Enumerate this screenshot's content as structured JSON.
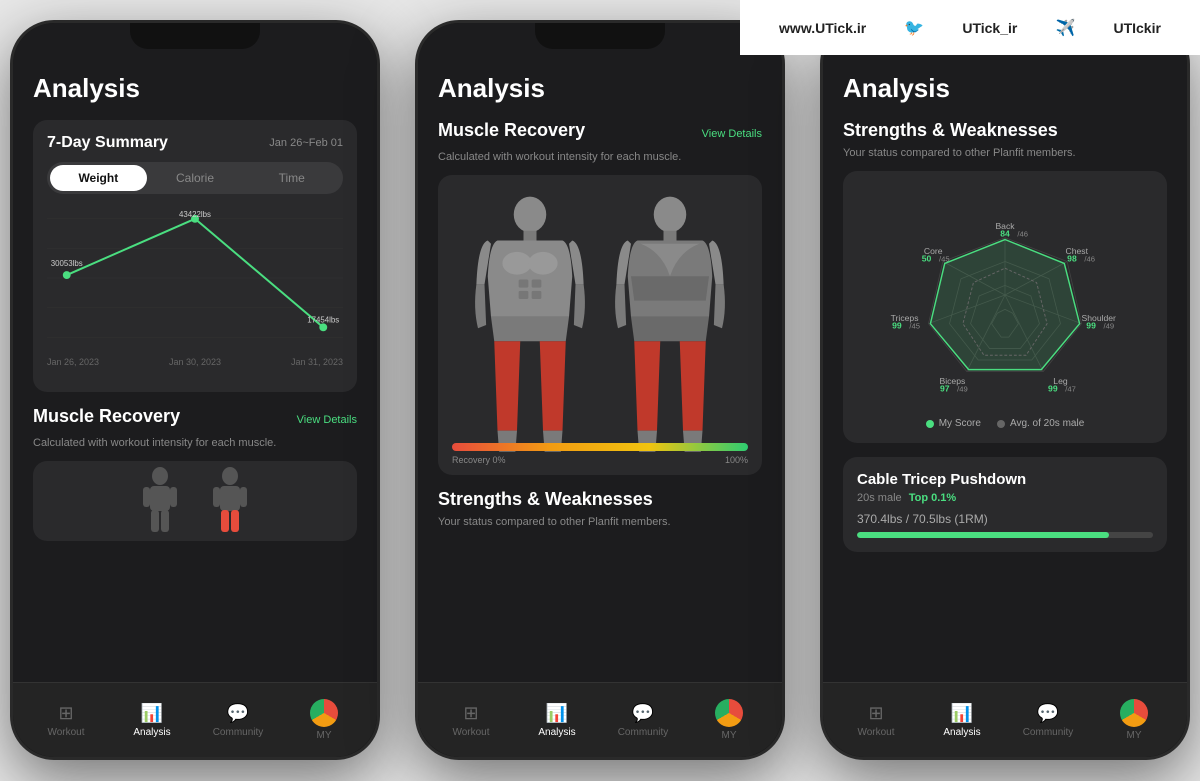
{
  "watermark": {
    "website": "www.UTick.ir",
    "twitter": "UTick_ir",
    "telegram": "UTIckir"
  },
  "phone1": {
    "title": "Analysis",
    "summary": {
      "label": "7-Day Summary",
      "date": "Jan 26~Feb 01"
    },
    "tabs": [
      "Weight",
      "Calorie",
      "Time"
    ],
    "active_tab": 0,
    "chart_points": [
      {
        "label": "Jan 26, 2023",
        "value": "30053lbs",
        "x": 0
      },
      {
        "label": "Jan 30, 2023",
        "value": "43422lbs",
        "x": 1
      },
      {
        "label": "Jan 31, 2023",
        "value": "17454lbs",
        "x": 2
      }
    ],
    "muscle_recovery": {
      "title": "Muscle Recovery",
      "view_details": "View Details",
      "subtitle": "Calculated with workout intensity for each muscle."
    },
    "nav": [
      {
        "label": "Workout",
        "active": false
      },
      {
        "label": "Analysis",
        "active": true
      },
      {
        "label": "Community",
        "active": false
      },
      {
        "label": "MY",
        "active": false
      }
    ]
  },
  "phone2": {
    "title": "Analysis",
    "muscle_recovery": {
      "title": "Muscle Recovery",
      "view_details": "View Details",
      "subtitle": "Calculated with workout intensity for each muscle."
    },
    "recovery_bar": {
      "min": "Recovery 0%",
      "max": "100%"
    },
    "strengths": {
      "title": "Strengths & Weaknesses",
      "subtitle": "Your status compared to other Planfit members."
    },
    "nav": [
      {
        "label": "Workout",
        "active": false
      },
      {
        "label": "Analysis",
        "active": true
      },
      {
        "label": "Community",
        "active": false
      },
      {
        "label": "MY",
        "active": false
      }
    ]
  },
  "phone3": {
    "title": "Analysis",
    "strengths": {
      "title": "Strengths & Weaknesses",
      "subtitle": "Your status compared to other Planfit members.",
      "metrics": [
        {
          "name": "Back",
          "my": 84,
          "avg": 46,
          "position": "top"
        },
        {
          "name": "Chest",
          "my": 98,
          "avg": 46,
          "position": "top-right"
        },
        {
          "name": "Shoulder",
          "my": 99,
          "avg": 49,
          "position": "right"
        },
        {
          "name": "Leg",
          "my": 99,
          "avg": 47,
          "position": "bottom-right"
        },
        {
          "name": "Biceps",
          "my": 97,
          "avg": 49,
          "position": "bottom-left"
        },
        {
          "name": "Triceps",
          "my": 99,
          "avg": 45,
          "position": "left"
        },
        {
          "name": "Core",
          "my": 50,
          "avg": 45,
          "position": "top-left"
        }
      ],
      "legend": [
        {
          "label": "My Score",
          "color": "#4ade80"
        },
        {
          "label": "Avg. of 20s male",
          "color": "#666"
        }
      ]
    },
    "exercise": {
      "title": "Cable Tricep Pushdown",
      "badge_prefix": "20s male",
      "badge_highlight": "Top 0.1%",
      "weight": "370.4lbs / 70.5lbs (1RM)",
      "progress": 85
    },
    "nav": [
      {
        "label": "Workout",
        "active": false
      },
      {
        "label": "Analysis",
        "active": true
      },
      {
        "label": "Community",
        "active": false
      },
      {
        "label": "MY",
        "active": false
      }
    ]
  }
}
